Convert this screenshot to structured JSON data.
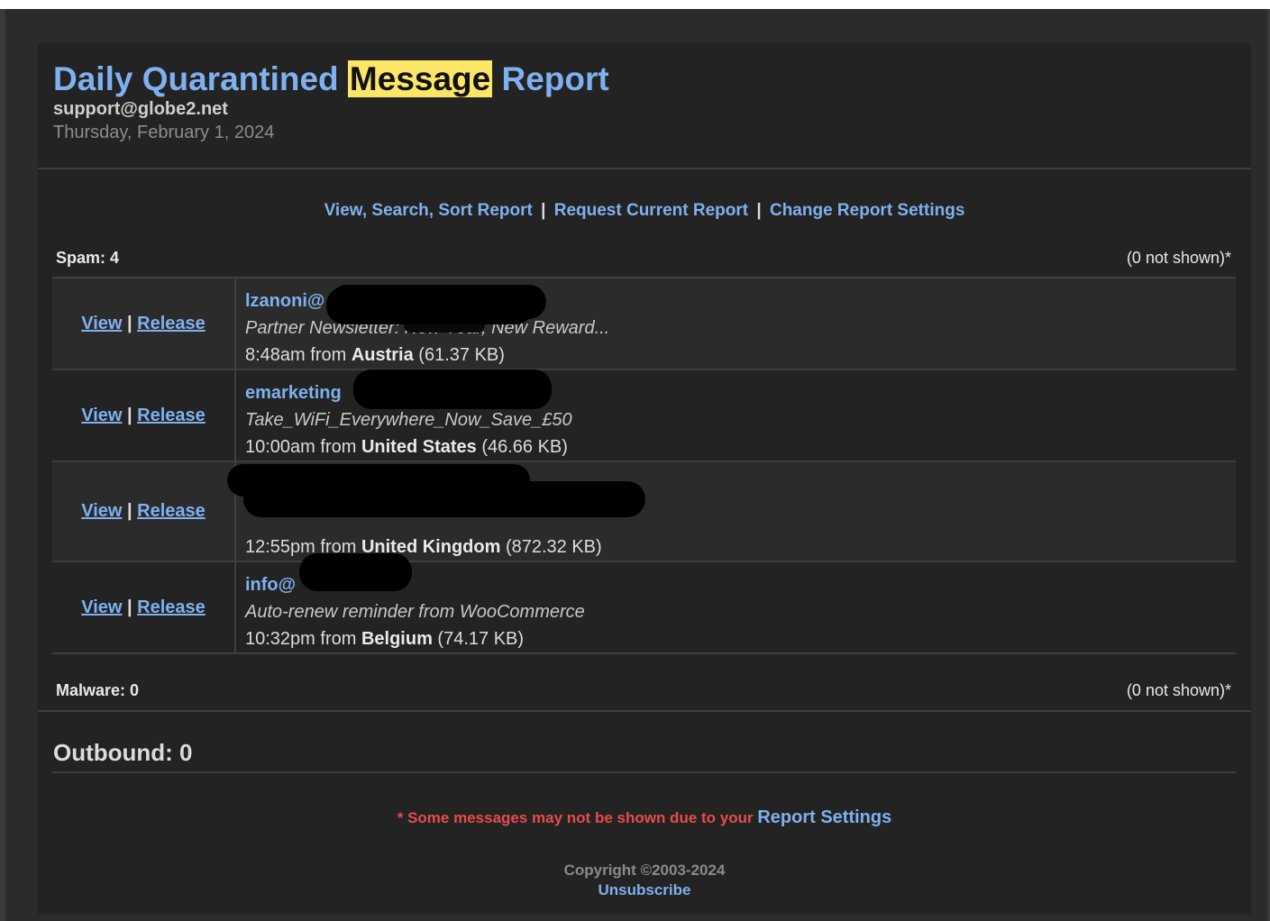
{
  "header": {
    "title_before": "Daily Quarantined ",
    "title_highlight": "Message",
    "title_after": " Report",
    "email": "support@globe2.net",
    "date": "Thursday, February 1, 2024"
  },
  "nav": {
    "view_search_sort": "View, Search, Sort Report",
    "request_current": "Request Current Report",
    "change_settings": "Change Report Settings",
    "separator": "|"
  },
  "spam": {
    "label": "Spam: 4",
    "not_shown": "(0 not shown)*",
    "messages": [
      {
        "view": "View",
        "release": "Release",
        "sender": "lzanoni@",
        "subject": "Partner Newsletter: New Year, New Reward...",
        "time": "8:48am from",
        "country": "Austria",
        "size": "(61.37 KB)"
      },
      {
        "view": "View",
        "release": "Release",
        "sender": "emarketing",
        "subject": "Take_WiFi_Everywhere_Now_Save_£50",
        "time": "10:00am from",
        "country": "United States",
        "size": "(46.66 KB)"
      },
      {
        "view": "View",
        "release": "Release",
        "sender": "",
        "subject": "",
        "time": "12:55pm from",
        "country": "United Kingdom",
        "size": "(872.32 KB)"
      },
      {
        "view": "View",
        "release": "Release",
        "sender": "info@",
        "subject": "Auto-renew reminder from WooCommerce",
        "time": "10:32pm from",
        "country": "Belgium",
        "size": "(74.17 KB)"
      }
    ]
  },
  "malware": {
    "label": "Malware: 0",
    "not_shown": "(0 not shown)*"
  },
  "outbound": {
    "label": "Outbound: 0"
  },
  "footer": {
    "note": "* Some messages may not be shown due to your ",
    "note_link": "Report Settings",
    "copyright": "Copyright ©2003-2024",
    "unsubscribe": "Unsubscribe"
  }
}
